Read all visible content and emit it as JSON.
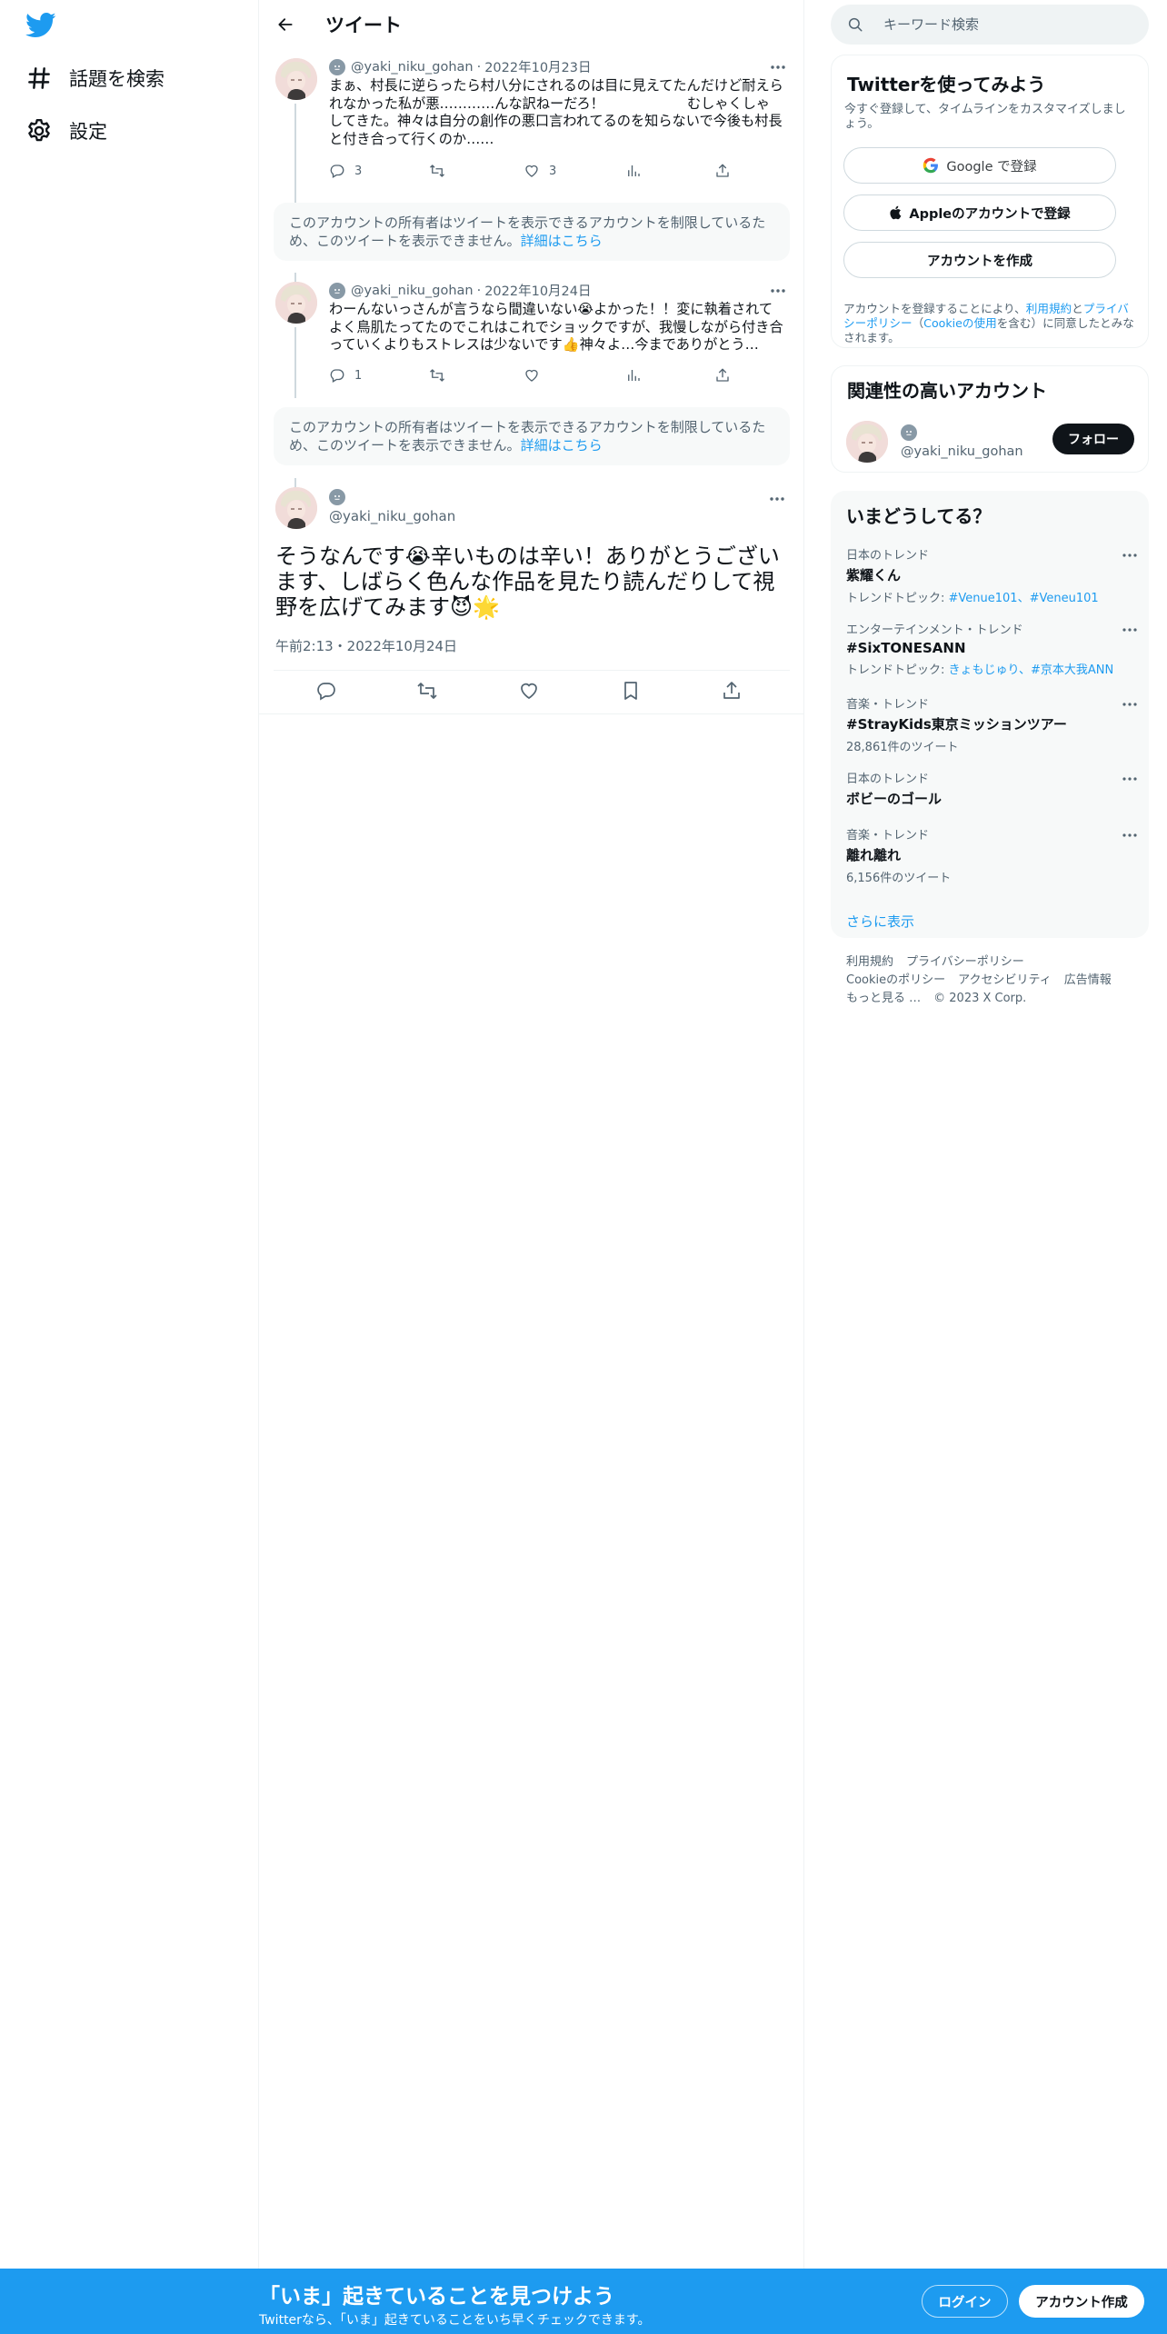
{
  "nav": {
    "explore_label": "話題を検索",
    "settings_label": "設定"
  },
  "header": {
    "title": "ツイート"
  },
  "tweets": [
    {
      "handle": "@yaki_niku_gohan",
      "date": "2022年10月23日",
      "text": "まぁ、村長に逆らったら村八分にされるのは目に見えてたんだけど耐えられなかった私が悪…………んな訳ねーだろ！　　　　　　むしゃくしゃしてきた。神々は自分の創作の悪口言われてるのを知らないで今後も村長と付き合って行くのか……",
      "replies": "3",
      "retweets": "",
      "likes": "3"
    },
    {
      "handle": "@yaki_niku_gohan",
      "date": "2022年10月24日",
      "text": "わーんないっさんが言うなら間違いない😭よかった！！変に執着されてよく鳥肌たってたのでこれはこれでショックですが、我慢しながら付き合っていくよりもストレスは少ないです👍神々よ…今までありがとう…",
      "replies": "1",
      "retweets": "",
      "likes": ""
    }
  ],
  "notice": {
    "text": "このアカウントの所有者はツイートを表示できるアカウントを制限しているため、このツイートを表示できません。",
    "link": "詳細はこちら"
  },
  "focus_tweet": {
    "handle": "@yaki_niku_gohan",
    "text": "そうなんです😭辛いものは辛い！ありがとうございます、しばらく色んな作品を見たり読んだりして視野を広げてみます😈🌟",
    "timestamp": "午前2:13・2022年10月24日"
  },
  "search": {
    "placeholder": "キーワード検索"
  },
  "signup_card": {
    "title": "Twitterを使ってみよう",
    "subtitle": "今すぐ登録して、タイムラインをカスタマイズしましょう。",
    "google_label": "Google で登録",
    "apple_label": "Appleのアカウントで登録",
    "create_label": "アカウントを作成",
    "terms_prefix": "アカウントを登録することにより、",
    "terms_link": "利用規約",
    "terms_and": "と",
    "privacy_link": "プライバシーポリシー",
    "paren_open": "（",
    "cookie_link": "Cookieの使用",
    "terms_suffix": "を含む）に同意したとみなされます。"
  },
  "related": {
    "title": "関連性の高いアカウント",
    "handle": "@yaki_niku_gohan",
    "follow_label": "フォロー"
  },
  "trends": {
    "title": "いまどうしてる？",
    "items": [
      {
        "context": "日本のトレンド",
        "name": "紫耀くん",
        "sub_prefix": "トレンドトピック: ",
        "sub_tags": "#Venue101、#Veneu101"
      },
      {
        "context": "エンターテインメント・トレンド",
        "name": "#SixTONESANN",
        "sub_prefix": "トレンドトピック: ",
        "sub_tags": "きょもじゅり、#京本大我ANN"
      },
      {
        "context": "音楽・トレンド",
        "name": "#StrayKids東京ミッションツアー",
        "sub": "28,861件のツイート"
      },
      {
        "context": "日本のトレンド",
        "name": "ボビーのゴール"
      },
      {
        "context": "音楽・トレンド",
        "name": "離れ離れ",
        "sub": "6,156件のツイート"
      }
    ],
    "show_more": "さらに表示"
  },
  "footer": {
    "links": [
      "利用規約",
      "プライバシーポリシー",
      "Cookieのポリシー",
      "アクセシビリティ",
      "広告情報",
      "もっと見る …"
    ],
    "copyright": "© 2023 X Corp."
  },
  "bottom_bar": {
    "title": "「いま」起きていることを見つけよう",
    "subtitle": "Twitterなら、「いま」起きていることをいち早くチェックできます。",
    "login_label": "ログイン",
    "signup_label": "アカウント作成"
  },
  "colors": {
    "accent": "#1d9bf0",
    "text": "#0f1419",
    "muted": "#536471"
  }
}
